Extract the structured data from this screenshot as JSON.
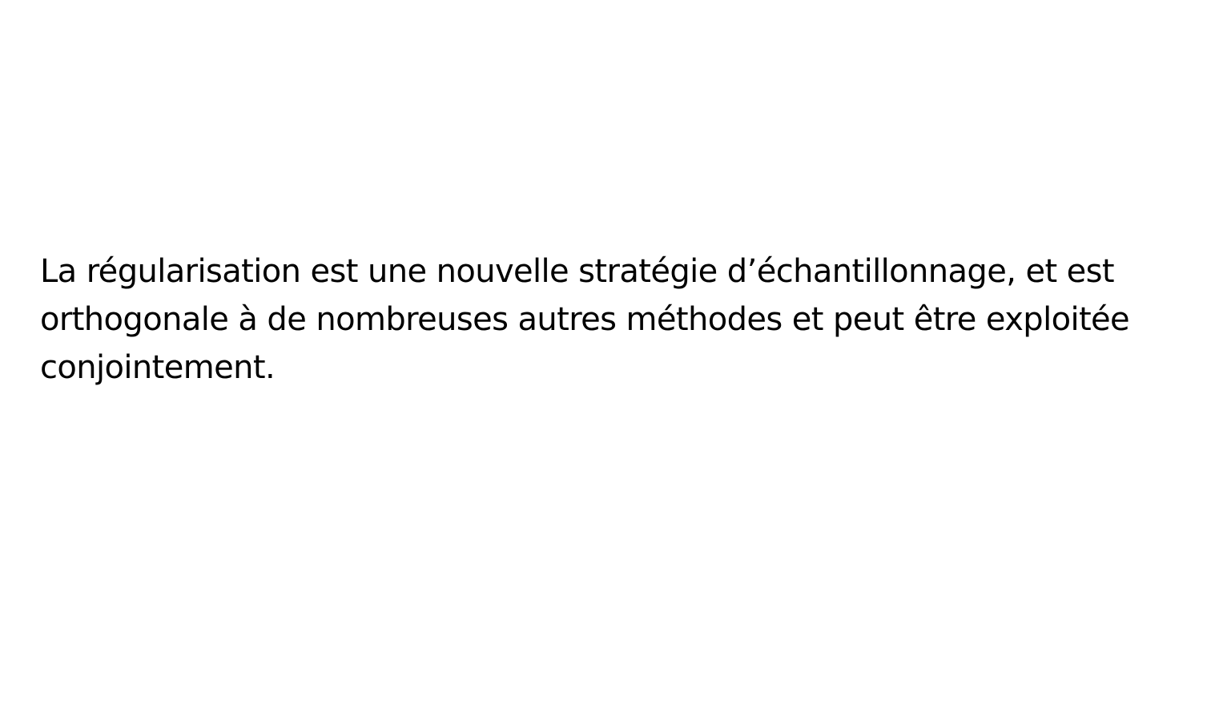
{
  "document": {
    "lines": [
      "La régularisation est une nouvelle stratégie d’échantillonnage, et est",
      "orthogonale à de nombreuses autres méthodes et peut être exploitée",
      "conjointement."
    ]
  }
}
